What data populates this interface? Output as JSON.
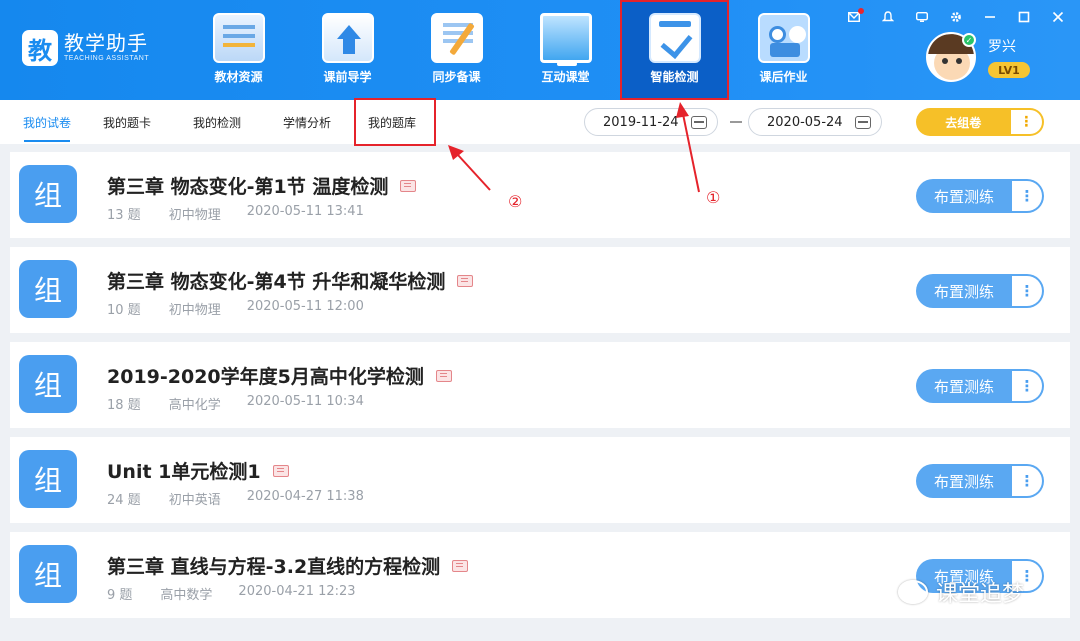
{
  "app": {
    "logo_char": "教",
    "title": "教学助手",
    "subtitle": "TEACHING ASSISTANT"
  },
  "nav": [
    {
      "label": "教材资源",
      "icon": "textbook-resource-icon"
    },
    {
      "label": "课前导学",
      "icon": "preview-guide-icon"
    },
    {
      "label": "同步备课",
      "icon": "lesson-prep-icon"
    },
    {
      "label": "互动课堂",
      "icon": "interactive-classroom-icon"
    },
    {
      "label": "智能检测",
      "icon": "smart-test-icon",
      "active": true
    },
    {
      "label": "课后作业",
      "icon": "homework-icon"
    }
  ],
  "window_controls": [
    "mail-icon",
    "bell-icon",
    "screen-icon",
    "gear-icon",
    "minimize-icon",
    "maximize-icon",
    "close-icon"
  ],
  "user": {
    "name": "罗兴",
    "level": "LV1"
  },
  "tabs": [
    {
      "label": "我的试卷",
      "active": true
    },
    {
      "label": "我的题卡"
    },
    {
      "label": "我的检测"
    },
    {
      "label": "学情分析"
    },
    {
      "label": "我的题库"
    }
  ],
  "filters": {
    "date_start": "2019-11-24",
    "date_end": "2020-05-24",
    "compose_label": "去组卷",
    "more": "⋮"
  },
  "papers": [
    {
      "badge": "组",
      "title": "第三章 物态变化-第1节 温度检测",
      "count": "13 题",
      "subject": "初中物理",
      "time": "2020-05-11 13:41",
      "action": "布置测练"
    },
    {
      "badge": "组",
      "title": "第三章 物态变化-第4节 升华和凝华检测",
      "count": "10 题",
      "subject": "初中物理",
      "time": "2020-05-11 12:00",
      "action": "布置测练"
    },
    {
      "badge": "组",
      "title": "2019-2020学年度5月高中化学检测",
      "count": "18 题",
      "subject": "高中化学",
      "time": "2020-05-11 10:34",
      "action": "布置测练"
    },
    {
      "badge": "组",
      "title": "Unit 1单元检测1",
      "count": "24 题",
      "subject": "初中英语",
      "time": "2020-04-27 11:38",
      "action": "布置测练"
    },
    {
      "badge": "组",
      "title": "第三章 直线与方程-3.2直线的方程检测",
      "count": "9 题",
      "subject": "高中数学",
      "time": "2020-04-21 12:23",
      "action": "布置测练"
    }
  ],
  "annotations": {
    "step1": "①",
    "step2": "②"
  },
  "watermark": "课堂追梦",
  "colors": {
    "header": "#1f8ff5",
    "accent": "#1a8cf0",
    "highlight": "#e5232b",
    "compose": "#f6c028"
  }
}
